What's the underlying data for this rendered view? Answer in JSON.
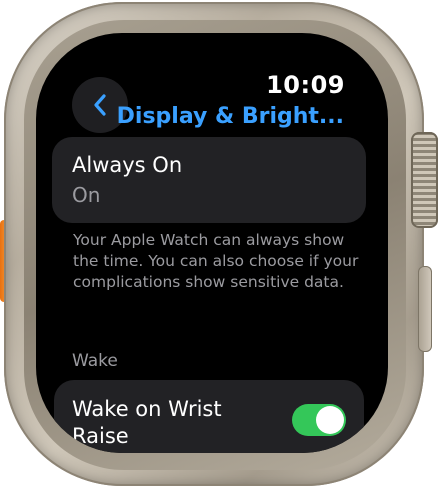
{
  "status": {
    "time": "10:09"
  },
  "nav": {
    "back_icon": "chevron-left-icon",
    "title": "Display & Bright..."
  },
  "always_on": {
    "title": "Always On",
    "value": "On"
  },
  "footnote": "Your Apple Watch can always show the time. You can also choose if your complications show sensitive data.",
  "wake_section": {
    "header": "Wake",
    "wake_on_wrist_raise": {
      "label": "Wake on Wrist Raise",
      "enabled": true
    }
  },
  "colors": {
    "accent": "#3aa0ff",
    "toggle_on": "#34c759",
    "cell_background": "#222225",
    "secondary_text": "#9b9ba0",
    "action_button": "#f28a22"
  }
}
